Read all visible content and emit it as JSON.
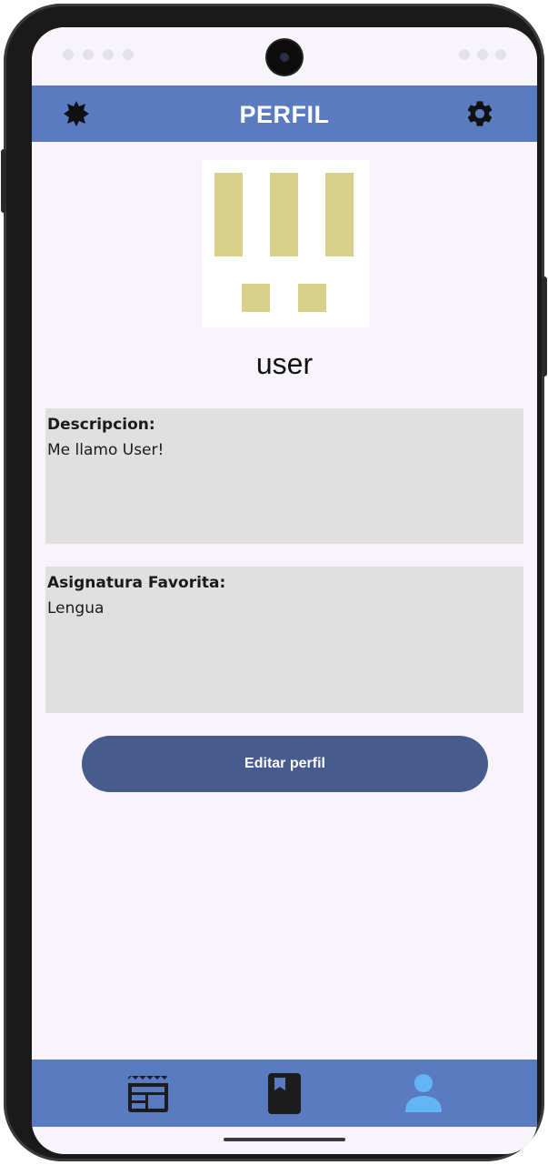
{
  "app_bar": {
    "title": "PERFIL",
    "left_icon": "badge-icon",
    "right_icon": "settings-gear-icon",
    "color": "#5b7bc0"
  },
  "profile": {
    "avatar_icon": "pixel-avatar-icon",
    "avatar_color": "#d8d08b",
    "username": "user",
    "description": {
      "label": "Descripcion:",
      "value": "Me llamo User!"
    },
    "favorite_subject": {
      "label": "Asignatura Favorita:",
      "value": "Lengua"
    },
    "edit_button_label": "Editar perfil",
    "button_color": "#475b8d"
  },
  "bottom_nav": {
    "items": [
      {
        "icon": "news-icon",
        "active": false
      },
      {
        "icon": "book-icon",
        "active": false
      },
      {
        "icon": "person-icon",
        "active": true
      }
    ],
    "active_color": "#64b5f6",
    "inactive_color": "#1c1c1c"
  }
}
